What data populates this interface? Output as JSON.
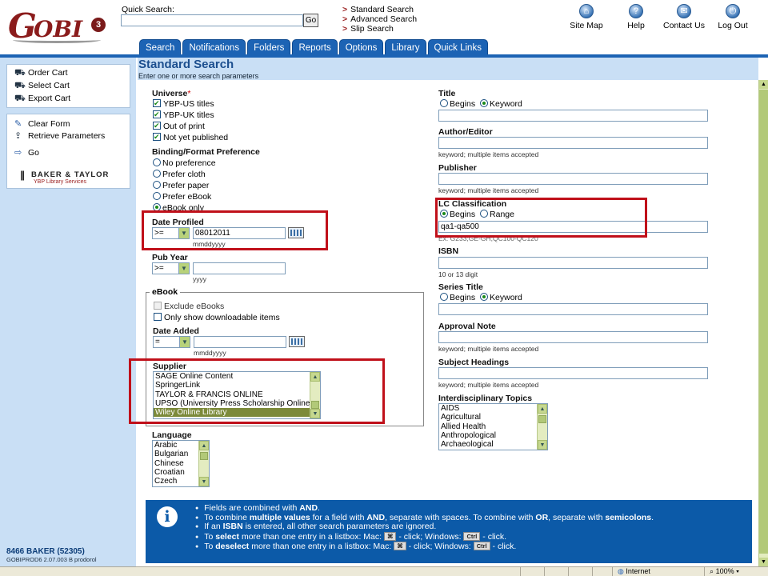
{
  "app": {
    "logo_text_g": "G",
    "logo_text_obi": "OBI",
    "logo_version": "3"
  },
  "quick_search": {
    "label": "Quick Search:",
    "value": "",
    "go_label": "Go"
  },
  "search_links": [
    {
      "label": "Standard Search"
    },
    {
      "label": "Advanced Search"
    },
    {
      "label": "Slip Search"
    }
  ],
  "toolbar": [
    {
      "label": "Site Map",
      "icon": "site-map-icon",
      "glyph": "⌂"
    },
    {
      "label": "Help",
      "icon": "help-icon",
      "glyph": "?"
    },
    {
      "label": "Contact Us",
      "icon": "contact-icon",
      "glyph": "✉"
    },
    {
      "label": "Log Out",
      "icon": "logout-icon",
      "glyph": "⏻"
    }
  ],
  "tabs": [
    "Search",
    "Notifications",
    "Folders",
    "Reports",
    "Options",
    "Library",
    "Quick Links"
  ],
  "sidebar": {
    "cart_items": [
      {
        "label": "Order Cart",
        "icon": "cart-icon",
        "glyph": "🛒"
      },
      {
        "label": "Select Cart",
        "icon": "cart-icon",
        "glyph": "🛒"
      },
      {
        "label": "Export Cart",
        "icon": "cart-icon",
        "glyph": "🛒"
      }
    ],
    "actions": [
      {
        "label": "Clear Form",
        "icon": "eraser-icon",
        "glyph": "✎"
      },
      {
        "label": "Retrieve Parameters",
        "icon": "retrieve-icon",
        "glyph": "⇧"
      },
      {
        "label": "Go",
        "icon": "arrow-right-icon",
        "glyph": "⇨"
      }
    ],
    "bt_logo_name": "BAKER & TAYLOR",
    "bt_logo_sub": "YBP Library Services",
    "account": "8466 BAKER (52305)",
    "build": "GOBIPROD6 2.07.003 B prodorol"
  },
  "page": {
    "title": "Standard Search",
    "subtitle": "Enter one or more search parameters"
  },
  "left": {
    "universe_label": "Universe",
    "universe_req": "*",
    "universe": [
      {
        "label": "YBP-US titles",
        "checked": true
      },
      {
        "label": "YBP-UK titles",
        "checked": true
      },
      {
        "label": "Out of print",
        "checked": true
      },
      {
        "label": "Not yet published",
        "checked": true
      }
    ],
    "binding_label": "Binding/Format Preference",
    "binding": [
      {
        "label": "No preference",
        "checked": false
      },
      {
        "label": "Prefer cloth",
        "checked": false
      },
      {
        "label": "Prefer paper",
        "checked": false
      },
      {
        "label": "Prefer eBook",
        "checked": false
      },
      {
        "label": "eBook only",
        "checked": true
      }
    ],
    "date_profiled_label": "Date Profiled",
    "date_profiled_op": ">=",
    "date_profiled_value": "08012011",
    "date_profiled_hint": "mmddyyyy",
    "pub_year_label": "Pub Year",
    "pub_year_op": ">=",
    "pub_year_value": "",
    "pub_year_hint": "yyyy",
    "ebook_label": "eBook",
    "exclude_ebooks": "Exclude eBooks",
    "only_downloadable": "Only show downloadable items",
    "date_added_label": "Date Added",
    "date_added_op": "=",
    "date_added_value": "",
    "date_added_hint": "mmddyyyy",
    "supplier_label": "Supplier",
    "suppliers": [
      {
        "label": "SAGE Online Content",
        "selected": false
      },
      {
        "label": "SpringerLink",
        "selected": false
      },
      {
        "label": "TAYLOR & FRANCIS ONLINE",
        "selected": false
      },
      {
        "label": "UPSO (University Press Scholarship Online)",
        "selected": false
      },
      {
        "label": "Wiley Online Library",
        "selected": true
      }
    ],
    "language_label": "Language",
    "languages": [
      "Arabic",
      "Bulgarian",
      "Chinese",
      "Croatian",
      "Czech"
    ]
  },
  "right": {
    "title_label": "Title",
    "title_opts": [
      {
        "label": "Begins",
        "checked": false
      },
      {
        "label": "Keyword",
        "checked": true
      }
    ],
    "author_label": "Author/Editor",
    "author_hint": "keyword; multiple items accepted",
    "publisher_label": "Publisher",
    "publisher_hint": "keyword; multiple items accepted",
    "lc_label": "LC Classification",
    "lc_opts": [
      {
        "label": "Begins",
        "checked": true
      },
      {
        "label": "Range",
        "checked": false
      }
    ],
    "lc_value": "qa1-qa500",
    "lc_hint": "Ex: G233;GE-GH;QC100-QC120",
    "isbn_label": "ISBN",
    "isbn_hint": "10 or 13 digit",
    "series_label": "Series Title",
    "series_opts": [
      {
        "label": "Begins",
        "checked": false
      },
      {
        "label": "Keyword",
        "checked": true
      }
    ],
    "approval_label": "Approval Note",
    "approval_hint": "keyword; multiple items accepted",
    "subject_label": "Subject Headings",
    "subject_hint": "keyword; multiple items accepted",
    "topics_label": "Interdisciplinary Topics",
    "topics": [
      "AIDS",
      "Agricultural",
      "Allied Health",
      "Anthropological",
      "Archaeological"
    ]
  },
  "info": {
    "lines": [
      [
        {
          "t": "Fields are combined with "
        },
        {
          "t": "AND",
          "b": true
        },
        {
          "t": "."
        }
      ],
      [
        {
          "t": "To combine "
        },
        {
          "t": "multiple values",
          "b": true
        },
        {
          "t": " for a field with "
        },
        {
          "t": "AND",
          "b": true
        },
        {
          "t": ", separate with spaces. To combine with "
        },
        {
          "t": "OR",
          "b": true
        },
        {
          "t": ", separate with "
        },
        {
          "t": "semicolons",
          "b": true
        },
        {
          "t": "."
        }
      ],
      [
        {
          "t": "If an "
        },
        {
          "t": "ISBN",
          "b": true
        },
        {
          "t": " is entered, all other search parameters are ignored."
        }
      ],
      [
        {
          "t": "To "
        },
        {
          "t": "select",
          "b": true
        },
        {
          "t": " more than one entry in a listbox: Mac: "
        },
        {
          "k": "⌘"
        },
        {
          "t": " - click; Windows: "
        },
        {
          "k": "Ctrl"
        },
        {
          "t": " - click."
        }
      ],
      [
        {
          "t": "To "
        },
        {
          "t": "deselect",
          "b": true
        },
        {
          "t": " more than one entry in a listbox: Mac: "
        },
        {
          "k": "⌘"
        },
        {
          "t": " - click; Windows: "
        },
        {
          "k": "Ctrl"
        },
        {
          "t": " - click."
        }
      ]
    ]
  },
  "status": {
    "zone": "Internet",
    "zoom": "100%"
  }
}
